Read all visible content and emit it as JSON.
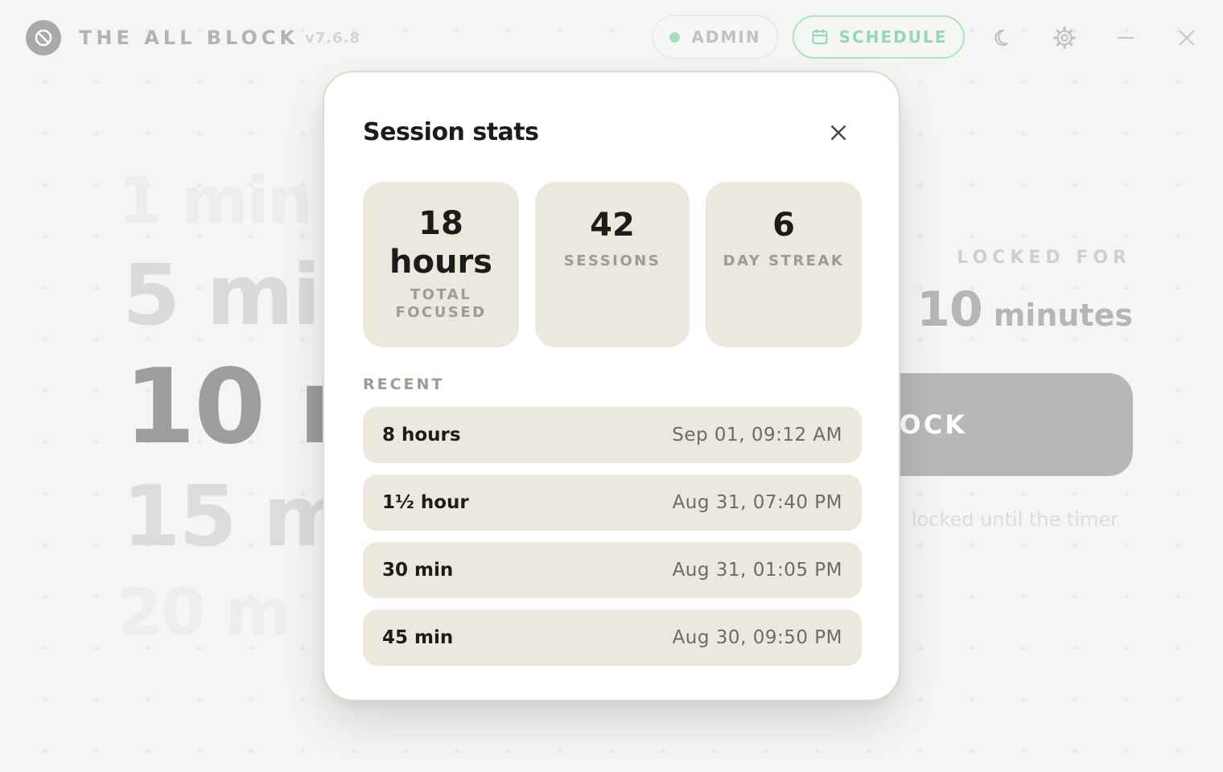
{
  "app": {
    "title": "THE ALL BLOCK",
    "version": "v7.6.8",
    "logo_icon": "block-icon",
    "admin_label": "ADMIN",
    "admin_status_color": "#a9dcbc",
    "schedule_label": "SCHEDULE",
    "schedule_icon": "calendar-icon",
    "accent_color": "#98d7b3"
  },
  "window_controls": [
    "moon-icon",
    "gear-icon",
    "minimize-icon",
    "close-icon"
  ],
  "picker": {
    "options": [
      "1 min",
      "5 mi",
      "10 m",
      "15 m",
      "20 m"
    ],
    "selected_index": 2
  },
  "locked": {
    "label": "LOCKED FOR",
    "value": "10",
    "unit": "minutes",
    "button_label": "OCK",
    "note": "locked until the timer"
  },
  "modal": {
    "title": "Session stats",
    "close_icon": "close-icon",
    "stats": {
      "total": {
        "value": "18 hours",
        "label": "TOTAL FOCUSED"
      },
      "sessions": {
        "value": "42",
        "label": "SESSIONS"
      },
      "streak": {
        "value": "6",
        "label": "DAY STREAK"
      }
    },
    "recent_label": "RECENT",
    "recent": [
      {
        "duration": "8 hours",
        "date": "Sep 01, 09:12 AM"
      },
      {
        "duration": "1½ hour",
        "date": "Aug 31, 07:40 PM"
      },
      {
        "duration": "30 min",
        "date": "Aug 31, 01:05 PM"
      },
      {
        "duration": "45 min",
        "date": "Aug 30, 09:50 PM"
      }
    ]
  }
}
